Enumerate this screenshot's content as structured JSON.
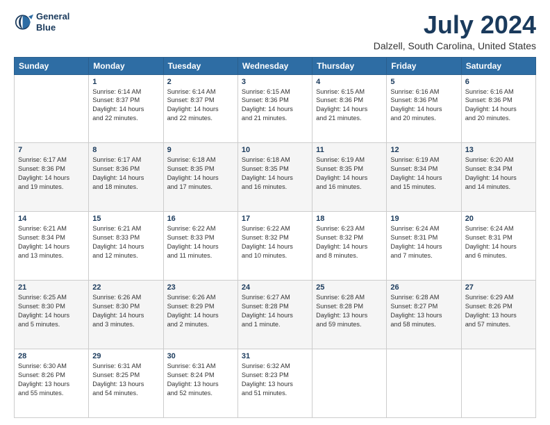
{
  "logo": {
    "line1": "General",
    "line2": "Blue"
  },
  "title": "July 2024",
  "subtitle": "Dalzell, South Carolina, United States",
  "days_of_week": [
    "Sunday",
    "Monday",
    "Tuesday",
    "Wednesday",
    "Thursday",
    "Friday",
    "Saturday"
  ],
  "weeks": [
    [
      {
        "day": "",
        "info": ""
      },
      {
        "day": "1",
        "info": "Sunrise: 6:14 AM\nSunset: 8:37 PM\nDaylight: 14 hours\nand 22 minutes."
      },
      {
        "day": "2",
        "info": "Sunrise: 6:14 AM\nSunset: 8:37 PM\nDaylight: 14 hours\nand 22 minutes."
      },
      {
        "day": "3",
        "info": "Sunrise: 6:15 AM\nSunset: 8:36 PM\nDaylight: 14 hours\nand 21 minutes."
      },
      {
        "day": "4",
        "info": "Sunrise: 6:15 AM\nSunset: 8:36 PM\nDaylight: 14 hours\nand 21 minutes."
      },
      {
        "day": "5",
        "info": "Sunrise: 6:16 AM\nSunset: 8:36 PM\nDaylight: 14 hours\nand 20 minutes."
      },
      {
        "day": "6",
        "info": "Sunrise: 6:16 AM\nSunset: 8:36 PM\nDaylight: 14 hours\nand 20 minutes."
      }
    ],
    [
      {
        "day": "7",
        "info": "Sunrise: 6:17 AM\nSunset: 8:36 PM\nDaylight: 14 hours\nand 19 minutes."
      },
      {
        "day": "8",
        "info": "Sunrise: 6:17 AM\nSunset: 8:36 PM\nDaylight: 14 hours\nand 18 minutes."
      },
      {
        "day": "9",
        "info": "Sunrise: 6:18 AM\nSunset: 8:35 PM\nDaylight: 14 hours\nand 17 minutes."
      },
      {
        "day": "10",
        "info": "Sunrise: 6:18 AM\nSunset: 8:35 PM\nDaylight: 14 hours\nand 16 minutes."
      },
      {
        "day": "11",
        "info": "Sunrise: 6:19 AM\nSunset: 8:35 PM\nDaylight: 14 hours\nand 16 minutes."
      },
      {
        "day": "12",
        "info": "Sunrise: 6:19 AM\nSunset: 8:34 PM\nDaylight: 14 hours\nand 15 minutes."
      },
      {
        "day": "13",
        "info": "Sunrise: 6:20 AM\nSunset: 8:34 PM\nDaylight: 14 hours\nand 14 minutes."
      }
    ],
    [
      {
        "day": "14",
        "info": "Sunrise: 6:21 AM\nSunset: 8:34 PM\nDaylight: 14 hours\nand 13 minutes."
      },
      {
        "day": "15",
        "info": "Sunrise: 6:21 AM\nSunset: 8:33 PM\nDaylight: 14 hours\nand 12 minutes."
      },
      {
        "day": "16",
        "info": "Sunrise: 6:22 AM\nSunset: 8:33 PM\nDaylight: 14 hours\nand 11 minutes."
      },
      {
        "day": "17",
        "info": "Sunrise: 6:22 AM\nSunset: 8:32 PM\nDaylight: 14 hours\nand 10 minutes."
      },
      {
        "day": "18",
        "info": "Sunrise: 6:23 AM\nSunset: 8:32 PM\nDaylight: 14 hours\nand 8 minutes."
      },
      {
        "day": "19",
        "info": "Sunrise: 6:24 AM\nSunset: 8:31 PM\nDaylight: 14 hours\nand 7 minutes."
      },
      {
        "day": "20",
        "info": "Sunrise: 6:24 AM\nSunset: 8:31 PM\nDaylight: 14 hours\nand 6 minutes."
      }
    ],
    [
      {
        "day": "21",
        "info": "Sunrise: 6:25 AM\nSunset: 8:30 PM\nDaylight: 14 hours\nand 5 minutes."
      },
      {
        "day": "22",
        "info": "Sunrise: 6:26 AM\nSunset: 8:30 PM\nDaylight: 14 hours\nand 3 minutes."
      },
      {
        "day": "23",
        "info": "Sunrise: 6:26 AM\nSunset: 8:29 PM\nDaylight: 14 hours\nand 2 minutes."
      },
      {
        "day": "24",
        "info": "Sunrise: 6:27 AM\nSunset: 8:28 PM\nDaylight: 14 hours\nand 1 minute."
      },
      {
        "day": "25",
        "info": "Sunrise: 6:28 AM\nSunset: 8:28 PM\nDaylight: 13 hours\nand 59 minutes."
      },
      {
        "day": "26",
        "info": "Sunrise: 6:28 AM\nSunset: 8:27 PM\nDaylight: 13 hours\nand 58 minutes."
      },
      {
        "day": "27",
        "info": "Sunrise: 6:29 AM\nSunset: 8:26 PM\nDaylight: 13 hours\nand 57 minutes."
      }
    ],
    [
      {
        "day": "28",
        "info": "Sunrise: 6:30 AM\nSunset: 8:26 PM\nDaylight: 13 hours\nand 55 minutes."
      },
      {
        "day": "29",
        "info": "Sunrise: 6:31 AM\nSunset: 8:25 PM\nDaylight: 13 hours\nand 54 minutes."
      },
      {
        "day": "30",
        "info": "Sunrise: 6:31 AM\nSunset: 8:24 PM\nDaylight: 13 hours\nand 52 minutes."
      },
      {
        "day": "31",
        "info": "Sunrise: 6:32 AM\nSunset: 8:23 PM\nDaylight: 13 hours\nand 51 minutes."
      },
      {
        "day": "",
        "info": ""
      },
      {
        "day": "",
        "info": ""
      },
      {
        "day": "",
        "info": ""
      }
    ]
  ]
}
